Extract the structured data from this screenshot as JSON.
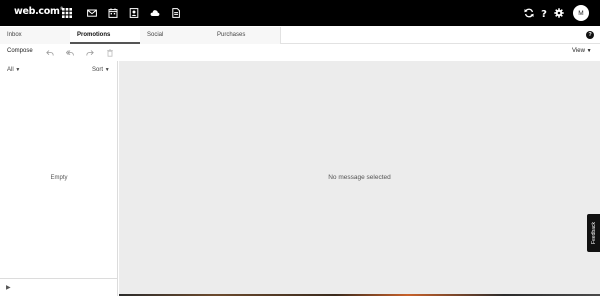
{
  "brand": {
    "name": "web.com",
    "reg": "®"
  },
  "topbar": {
    "icons": [
      "apps-grid-icon",
      "mail-icon",
      "calendar-icon",
      "contacts-icon",
      "cloud-icon",
      "notes-icon"
    ],
    "right_icons": [
      "refresh-icon",
      "help-icon",
      "settings-icon"
    ],
    "avatar_initial": "M"
  },
  "tabs": [
    {
      "label": "Inbox",
      "active": false
    },
    {
      "label": "Promotions",
      "active": true
    },
    {
      "label": "Social",
      "active": false
    },
    {
      "label": "Purchases",
      "active": false
    }
  ],
  "help_glyph": "?",
  "toolbar": {
    "compose_label": "Compose",
    "view_label": "View"
  },
  "list": {
    "filter_label": "All",
    "sort_label": "Sort",
    "empty_text": "Empty"
  },
  "reader": {
    "empty_text": "No message selected"
  },
  "feedback_label": "Feedback",
  "colors": {
    "topbar": "#000000",
    "reader_bg": "#ececec",
    "accent": "#555555"
  }
}
